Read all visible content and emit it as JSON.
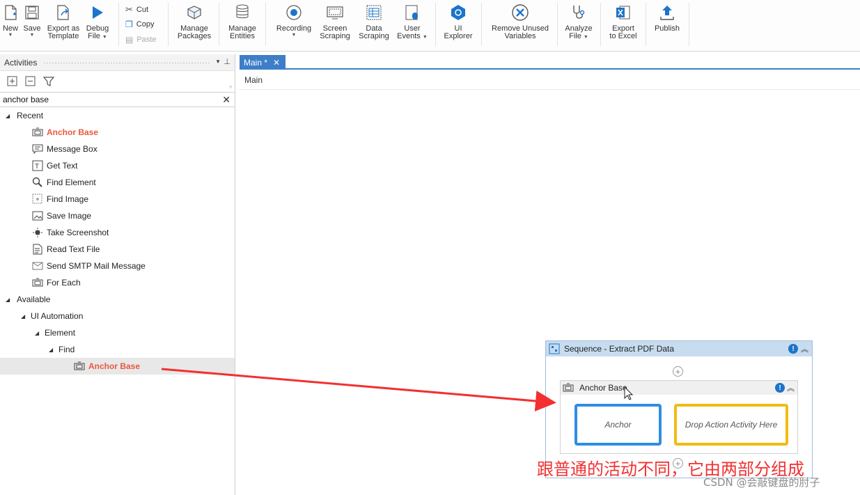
{
  "ribbon": {
    "new": "New",
    "save": "Save",
    "export_template": [
      "Export as",
      "Template"
    ],
    "debug": [
      "Debug",
      "File"
    ],
    "cut": "Cut",
    "copy": "Copy",
    "paste": "Paste",
    "manage_packages": [
      "Manage",
      "Packages"
    ],
    "manage_entities": [
      "Manage",
      "Entities"
    ],
    "recording": "Recording",
    "screen_scraping": [
      "Screen",
      "Scraping"
    ],
    "data_scraping": [
      "Data",
      "Scraping"
    ],
    "user_events": [
      "User",
      "Events"
    ],
    "ui_explorer": [
      "UI",
      "Explorer"
    ],
    "remove_unused": [
      "Remove Unused",
      "Variables"
    ],
    "analyze": [
      "Analyze",
      "File"
    ],
    "export_excel": [
      "Export",
      "to Excel"
    ],
    "publish": "Publish"
  },
  "activities_panel": {
    "title": "Activities",
    "search_value": "anchor base",
    "tree": {
      "recent_label": "Recent",
      "recent_items": [
        "Anchor Base",
        "Message Box",
        "Get Text",
        "Find Element",
        "Find Image",
        "Save Image",
        "Take Screenshot",
        "Read Text File",
        "Send SMTP Mail Message",
        "For Each"
      ],
      "available_label": "Available",
      "ui_automation": "UI Automation",
      "element": "Element",
      "find": "Find",
      "match": "Anchor Base"
    }
  },
  "designer": {
    "tab_label": "Main *",
    "breadcrumb": "Main",
    "sequence_title": "Sequence - Extract PDF Data",
    "anchor_title": "Anchor Base",
    "anchor_slot": "Anchor",
    "action_slot": "Drop Action Activity Here",
    "info_glyph": "!"
  },
  "annotation": "跟普通的活动不同，它由两部分组成",
  "watermark": "CSDN @会敲键盘的肘子",
  "colors": {
    "accent": "#3e7ec8",
    "highlight": "#e8593c",
    "anchor_border": "#2f8de4",
    "action_border": "#f2bb14",
    "annotation": "#f23030"
  }
}
